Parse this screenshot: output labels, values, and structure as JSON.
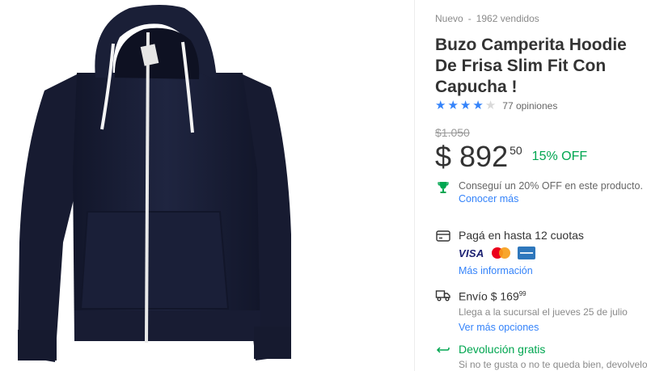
{
  "product": {
    "condition": "Nuevo",
    "sold": "1962 vendidos",
    "title": "Buzo Camperita Hoodie De Frisa Slim Fit Con Capucha !",
    "image_icon": "navy-hoodie-image"
  },
  "rating": {
    "stars": 4,
    "max_stars": 5,
    "reviews": "77 opiniones"
  },
  "price": {
    "original": "$1.050",
    "amount": "$ 892",
    "cents": "50",
    "discount": "15% OFF"
  },
  "promo": {
    "text": "Conseguí un 20% OFF en este producto.",
    "link": "Conocer más",
    "icon": "trophy-icon"
  },
  "payment": {
    "text": "Pagá en hasta 12 cuotas",
    "cards": [
      "VISA",
      "mastercard",
      "american-express"
    ],
    "link": "Más información",
    "icon": "credit-card-icon"
  },
  "shipping": {
    "label": "Envío $ 169",
    "cents": "99",
    "eta": "Llega a la sucursal el jueves 25 de julio",
    "link": "Ver más opciones",
    "icon": "truck-icon"
  },
  "returns": {
    "label": "Devolución gratis",
    "text": "Si no te gusta o no te queda bien, devolvelo",
    "icon": "return-arrow-icon"
  },
  "colors": {
    "accent": "#3483fa",
    "green": "#00a650",
    "hoodie": "#1b2038"
  }
}
